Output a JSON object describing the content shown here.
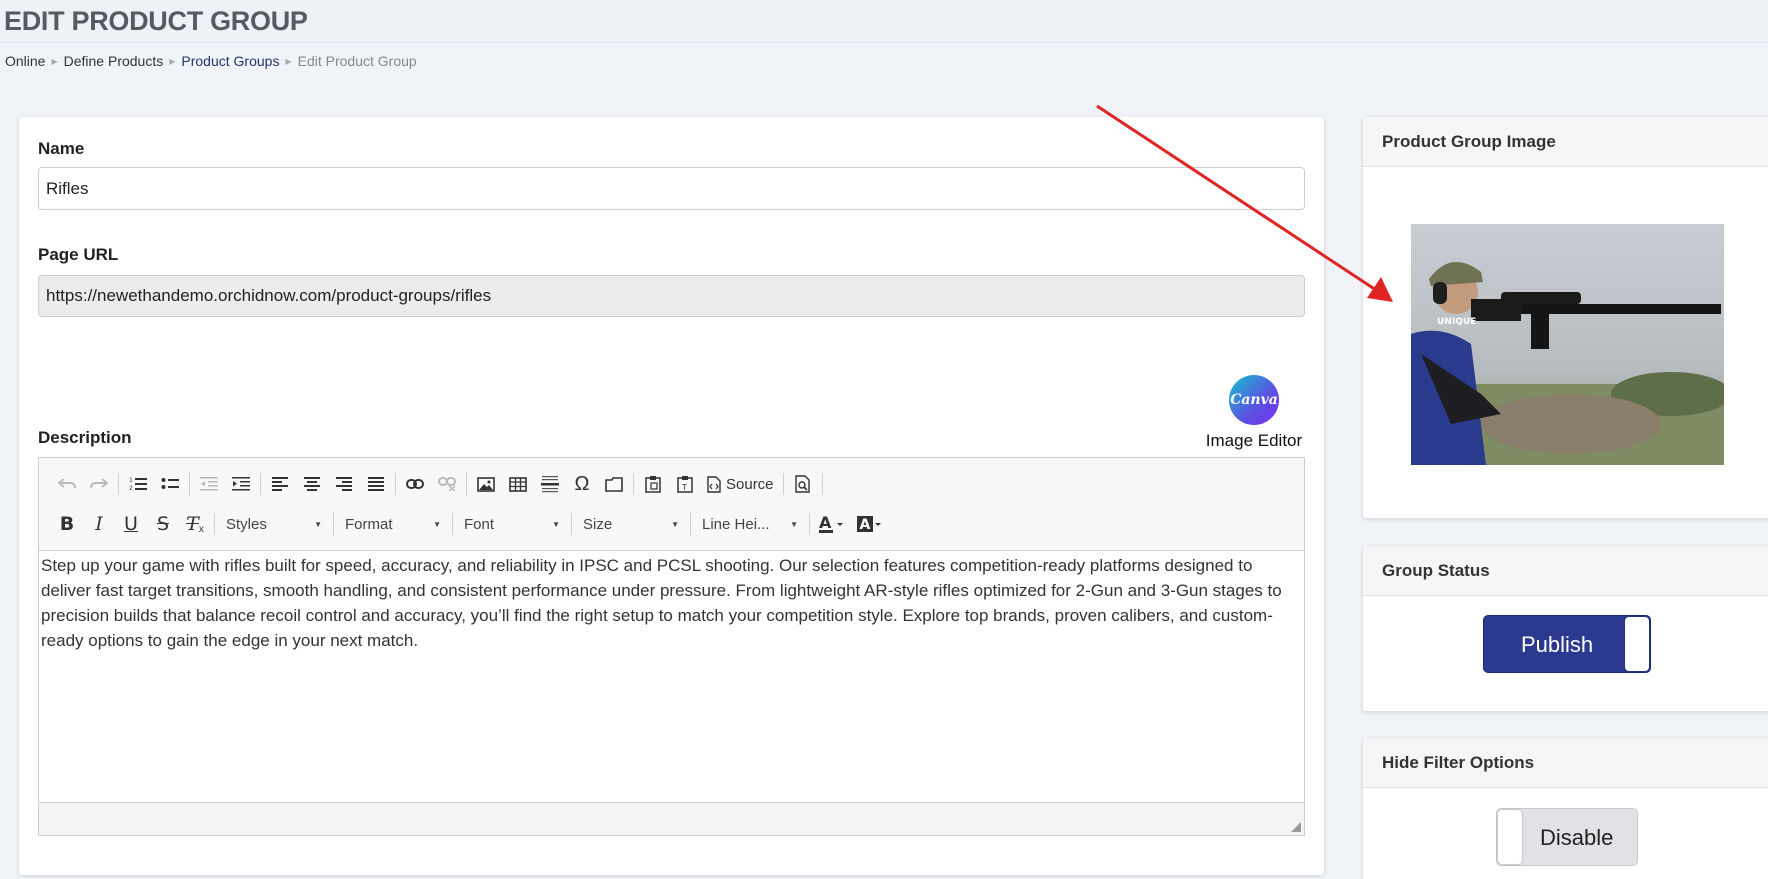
{
  "page": {
    "title": "EDIT PRODUCT GROUP"
  },
  "breadcrumb": [
    "Online",
    "Define Products",
    "Product Groups",
    "Edit Product Group"
  ],
  "form": {
    "name_label": "Name",
    "name_value": "Rifles",
    "url_label": "Page URL",
    "url_value": "https://newethandemo.orchidnow.com/product-groups/rifles",
    "description_label": "Description",
    "description_text": "Step up your game with rifles built for speed, accuracy, and reliability in IPSC and PCSL shooting. Our selection features competition-ready platforms designed to deliver fast target transitions, smooth handling, and consistent performance under pressure. From lightweight AR-style rifles optimized for 2-Gun and 3-Gun stages to precision builds that balance recoil control and accuracy, you’ll find the right setup to match your competition style. Explore top brands, proven calibers, and custom-ready options to gain the edge in your next match."
  },
  "canva": {
    "logo_text": "Canva",
    "label": "Image Editor"
  },
  "editor": {
    "source_label": "Source",
    "combos": {
      "styles": "Styles",
      "format": "Format",
      "font": "Font",
      "size": "Size",
      "line_height": "Line Hei..."
    },
    "bold": "B",
    "italic": "I",
    "underline": "U",
    "strike": "S",
    "clear": "T",
    "omega": "Ω"
  },
  "image_panel": {
    "title": "Product Group Image",
    "photo_text": "UNIQUE"
  },
  "group_status": {
    "title": "Group Status",
    "toggle_label": "Publish",
    "state": "on"
  },
  "hide_filter": {
    "title": "Hide Filter Options",
    "toggle_label": "Disable",
    "state": "off"
  },
  "colors": {
    "brand": "#2b3990",
    "annotation_arrow": "#e02424"
  }
}
